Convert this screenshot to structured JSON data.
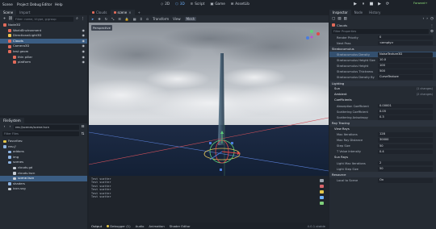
{
  "menubar": {
    "items": [
      "Scene",
      "Project",
      "Debug",
      "Editor",
      "Help"
    ],
    "modes": [
      {
        "label": "2D",
        "active": false
      },
      {
        "label": "3D",
        "active": true
      },
      {
        "label": "Script",
        "active": false
      },
      {
        "label": "Game",
        "active": false
      },
      {
        "label": "AssetLib",
        "active": false
      }
    ],
    "play_buttons": [
      "▶",
      "⏸",
      "■",
      "▶",
      "⟳"
    ],
    "renderer": "Forward+"
  },
  "scene_dock": {
    "tabs": [
      "Scene",
      "Import"
    ],
    "filter_placeholder": "Filter: name, t:type, g:group",
    "tree": [
      {
        "label": "Node3D",
        "depth": 0,
        "color": "#e26b5a"
      },
      {
        "label": "WorldEnvironment",
        "depth": 1,
        "color": "#e26b5a"
      },
      {
        "label": "DirectionalLight3D",
        "depth": 1,
        "color": "#f0c64e"
      },
      {
        "label": "Clouds",
        "depth": 1,
        "color": "#e26b5a",
        "selected": true
      },
      {
        "label": "Camera3D",
        "depth": 1,
        "color": "#e26b5a"
      },
      {
        "label": "test geom",
        "depth": 1,
        "color": "#e26b5a"
      },
      {
        "label": "thin pillar",
        "depth": 2,
        "color": "#e26b5a"
      },
      {
        "label": "platform",
        "depth": 2,
        "color": "#e26b5a"
      }
    ]
  },
  "filesystem_dock": {
    "tab": "FileSystem",
    "path": "res://scenes/scene.tscn",
    "filter_placeholder": "Filter Files",
    "items": [
      {
        "label": "Favorites:",
        "depth": 0,
        "color": "#e5c84a"
      },
      {
        "label": "res://",
        "depth": 0,
        "color": "#8db4e3"
      },
      {
        "label": "addons",
        "depth": 1,
        "color": "#8db4e3"
      },
      {
        "label": "img",
        "depth": 1,
        "color": "#8db4e3"
      },
      {
        "label": "scenes",
        "depth": 1,
        "color": "#8db4e3"
      },
      {
        "label": "clouds.gd",
        "depth": 2,
        "color": "#c6ccd4"
      },
      {
        "label": "clouds.tscn",
        "depth": 2,
        "color": "#c6ccd4"
      },
      {
        "label": "scene.tscn",
        "depth": 2,
        "color": "#c6ccd4",
        "selected": true
      },
      {
        "label": "shaders",
        "depth": 1,
        "color": "#8db4e3"
      },
      {
        "label": "icon.svg",
        "depth": 1,
        "color": "#c6ccd4"
      }
    ]
  },
  "editor_tabs": [
    "Clouds",
    "scene"
  ],
  "viewport_toolbar": [
    "Transform",
    "View",
    "Mesh"
  ],
  "viewport_label": "Perspective",
  "output": {
    "lines": [
      "Test scatter",
      "Test scatter",
      "Test scatter",
      "Test scatter",
      "Test scatter",
      "Test scatter"
    ],
    "filter_placeholder": "Filter Messages"
  },
  "bottom_tabs": [
    "Output",
    "Debugger (1)",
    "Audio",
    "Animation",
    "Shader Editor"
  ],
  "version": "4.0.1.stable",
  "inspector": {
    "tabs": [
      "Inspector",
      "Node",
      "History"
    ],
    "object": "Clouds",
    "filter_placeholder": "Filter Properties",
    "rows": [
      {
        "kind": "prop",
        "label": "Render Priority",
        "value": "0"
      },
      {
        "kind": "prop",
        "label": "Next Pass",
        "value": "<empty>"
      },
      {
        "kind": "section",
        "label": "Stratocumulus"
      },
      {
        "kind": "prop",
        "label": "Stratocumulus Density",
        "value": "NoiseTexture3D",
        "hl": true
      },
      {
        "kind": "prop",
        "label": "Stratocumulus Height Size",
        "value": "10.0"
      },
      {
        "kind": "prop",
        "label": "Stratocumulus Height",
        "value": "100"
      },
      {
        "kind": "prop",
        "label": "Stratocumulus Thickness",
        "value": "500"
      },
      {
        "kind": "prop",
        "label": "Stratocumulus Density By",
        "value": "CurveTexture"
      },
      {
        "kind": "section",
        "label": "Lighting"
      },
      {
        "kind": "subsec",
        "label": "Sun",
        "count": "(1 changes)"
      },
      {
        "kind": "subsec",
        "label": "Ambient",
        "count": "(2 changes)"
      },
      {
        "kind": "subsec",
        "label": "Coefficients",
        "count": ""
      },
      {
        "kind": "prop",
        "label": "Absorption Coefficient",
        "value": "0.00001"
      },
      {
        "kind": "prop",
        "label": "Scattering Coefficient",
        "value": "0.05"
      },
      {
        "kind": "prop",
        "label": "Scattering Anisotropy",
        "value": "0.3"
      },
      {
        "kind": "section",
        "label": "Ray Tracing"
      },
      {
        "kind": "subsec",
        "label": "View Rays",
        "count": ""
      },
      {
        "kind": "prop",
        "label": "Max Iterations",
        "value": "128"
      },
      {
        "kind": "prop",
        "label": "Max Ray Distance",
        "value": "30000"
      },
      {
        "kind": "prop",
        "label": "Step Size",
        "value": "50"
      },
      {
        "kind": "prop",
        "label": "T Value Intensity",
        "value": "0.4"
      },
      {
        "kind": "subsec",
        "label": "Sun Rays",
        "count": ""
      },
      {
        "kind": "prop",
        "label": "Light Max Iterations",
        "value": "2"
      },
      {
        "kind": "prop",
        "label": "Light Step Size",
        "value": "50"
      },
      {
        "kind": "section",
        "label": "Resource"
      },
      {
        "kind": "prop",
        "label": "Local to Scene",
        "value": "On"
      }
    ]
  }
}
